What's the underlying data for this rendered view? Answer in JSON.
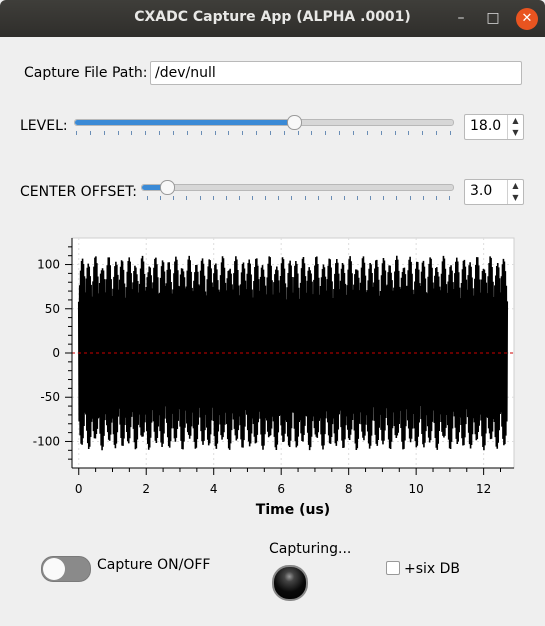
{
  "window": {
    "title": "CXADC Capture App  (ALPHA .0001)",
    "minimize_glyph": "–",
    "maximize_glyph": "□",
    "close_glyph": "✕"
  },
  "capture_path": {
    "label": "Capture File Path:",
    "value": "/dev/null"
  },
  "level": {
    "label": "LEVEL:",
    "value": "18.0",
    "slider_fraction": 0.58
  },
  "center_offset": {
    "label": "CENTER OFFSET:",
    "value": "3.0",
    "slider_fraction": 0.08
  },
  "capture": {
    "toggle_label": "Capture ON/OFF",
    "toggle_on": false,
    "status_label": "Capturing...",
    "six_db_label": "+six DB",
    "six_db_checked": false
  },
  "colors": {
    "accent": "#3a8ad6",
    "close": "#e95420",
    "signal": "#000000",
    "center_line": "#cc0000"
  },
  "chart_data": {
    "type": "line",
    "title": "",
    "xlabel": "Time (us)",
    "ylabel": "",
    "xlim": [
      -0.2,
      12.9
    ],
    "ylim": [
      -130,
      130
    ],
    "x_ticks": [
      "0",
      "2",
      "4",
      "6",
      "8",
      "10",
      "12"
    ],
    "y_ticks": [
      "100",
      "50",
      "0",
      "-50",
      "-100"
    ],
    "grid": true,
    "signal": {
      "x_start": 0,
      "x_end": 12.7,
      "envelope_max": 110,
      "envelope_min": -110,
      "burst_count": 64
    },
    "center_line": 0
  }
}
